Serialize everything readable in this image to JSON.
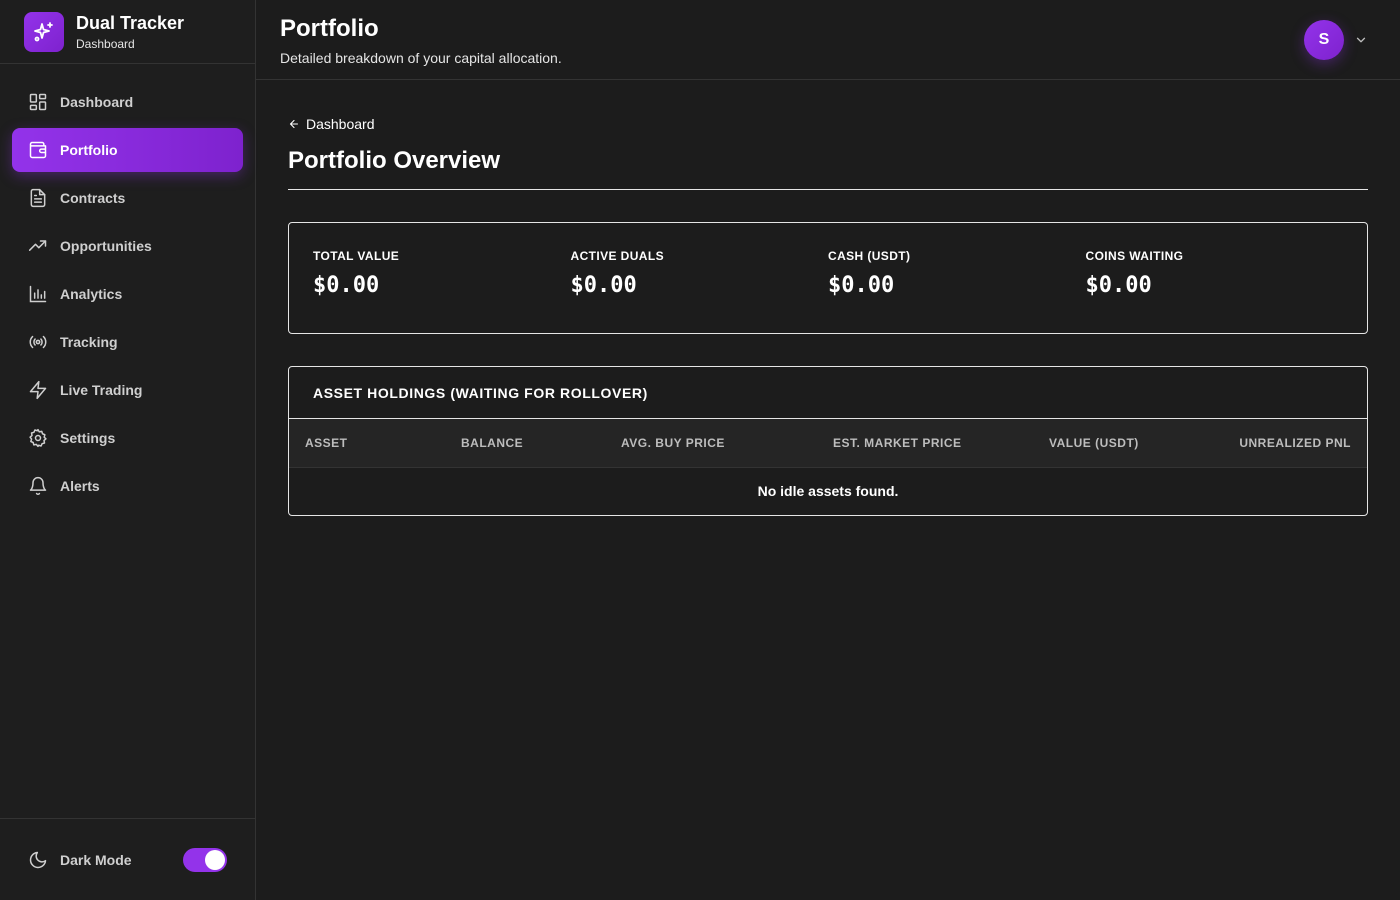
{
  "brand": {
    "title": "Dual Tracker",
    "subtitle": "Dashboard",
    "accent": "#9333ea"
  },
  "sidebar": {
    "items": [
      {
        "label": "Dashboard",
        "icon": "grid-icon",
        "active": false
      },
      {
        "label": "Portfolio",
        "icon": "wallet-icon",
        "active": true
      },
      {
        "label": "Contracts",
        "icon": "document-icon",
        "active": false
      },
      {
        "label": "Opportunities",
        "icon": "trending-up-icon",
        "active": false
      },
      {
        "label": "Analytics",
        "icon": "bar-chart-icon",
        "active": false
      },
      {
        "label": "Tracking",
        "icon": "radio-icon",
        "active": false
      },
      {
        "label": "Live Trading",
        "icon": "lightning-icon",
        "active": false
      },
      {
        "label": "Settings",
        "icon": "gear-icon",
        "active": false
      },
      {
        "label": "Alerts",
        "icon": "bell-icon",
        "active": false
      }
    ],
    "footer": {
      "label": "Dark Mode",
      "icon": "moon-icon",
      "enabled": true
    }
  },
  "header": {
    "title": "Portfolio",
    "subtitle": "Detailed breakdown of your capital allocation.",
    "user_initial": "S"
  },
  "main": {
    "back_label": "Dashboard",
    "title": "Portfolio Overview",
    "stats": [
      {
        "label": "TOTAL VALUE",
        "value": "$0.00"
      },
      {
        "label": "ACTIVE DUALS",
        "value": "$0.00"
      },
      {
        "label": "CASH (USDT)",
        "value": "$0.00"
      },
      {
        "label": "COINS WAITING",
        "value": "$0.00"
      }
    ],
    "holdings": {
      "title": "ASSET HOLDINGS (WAITING FOR ROLLOVER)",
      "columns": [
        "ASSET",
        "BALANCE",
        "AVG. BUY PRICE",
        "EST. MARKET PRICE",
        "VALUE (USDT)",
        "UNREALIZED PNL"
      ],
      "empty_text": "No idle assets found."
    }
  }
}
